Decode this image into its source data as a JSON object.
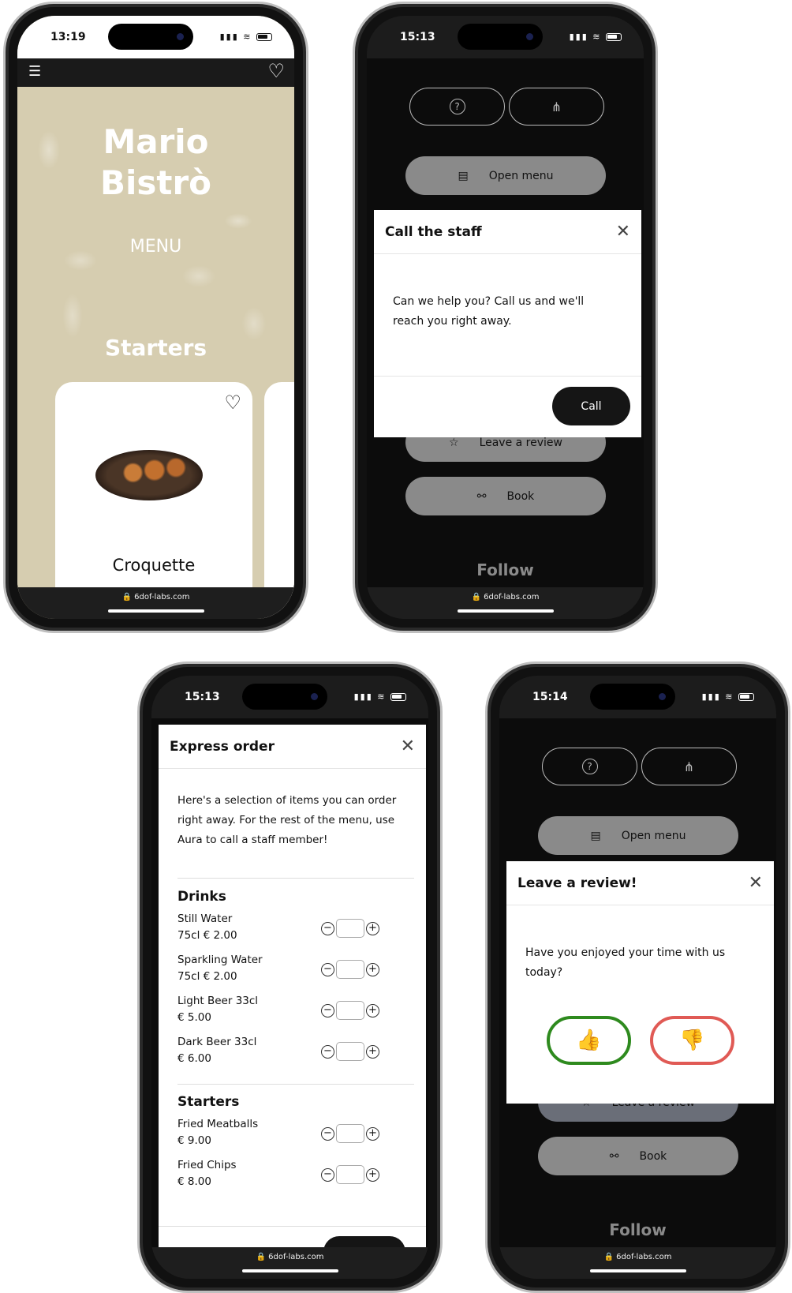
{
  "phones": [
    {
      "time": "13:19",
      "url": "6dof-labs.com",
      "title_line1": "Mario",
      "title_line2": "Bistrò",
      "subtitle": "MENU",
      "section": "Starters",
      "card_name": "Croquette"
    },
    {
      "time": "15:13",
      "url": "6dof-labs.com",
      "open_menu": "Open menu",
      "leave_review": "Leave a review",
      "book": "Book",
      "follow": "Follow",
      "modal": {
        "title": "Call the staff",
        "text": "Can we help you? Call us and we'll reach you right away.",
        "button": "Call"
      }
    },
    {
      "time": "15:13",
      "url": "6dof-labs.com",
      "modal": {
        "title": "Express order",
        "text": "Here's a selection of items you can order right away. For the rest of the menu, use Aura to call a staff member!",
        "sections": [
          {
            "name": "Drinks",
            "items": [
              {
                "name": "Still Water",
                "price": "75cl € 2.00"
              },
              {
                "name": "Sparkling Water",
                "price": "75cl € 2.00"
              },
              {
                "name": "Light Beer 33cl",
                "price": "€ 5.00"
              },
              {
                "name": "Dark Beer 33cl",
                "price": "€ 6.00"
              }
            ]
          },
          {
            "name": "Starters",
            "items": [
              {
                "name": "Fried Meatballs",
                "price": "€ 9.00"
              },
              {
                "name": "Fried Chips",
                "price": "€ 8.00"
              }
            ]
          }
        ]
      }
    },
    {
      "time": "15:14",
      "url": "6dof-labs.com",
      "open_menu": "Open menu",
      "leave_review": "Leave a review",
      "book": "Book",
      "follow": "Follow",
      "modal": {
        "title": "Leave a review!",
        "text": "Have you enjoyed your time with us today?",
        "positive_icon": "thumbs-up-icon",
        "negative_icon": "thumbs-down-icon"
      }
    }
  ],
  "colors": {
    "hero": "#d6cdb0",
    "positive": "#2e8a1e",
    "negative": "#e05a55",
    "button_gray": "#8a8a8a"
  }
}
